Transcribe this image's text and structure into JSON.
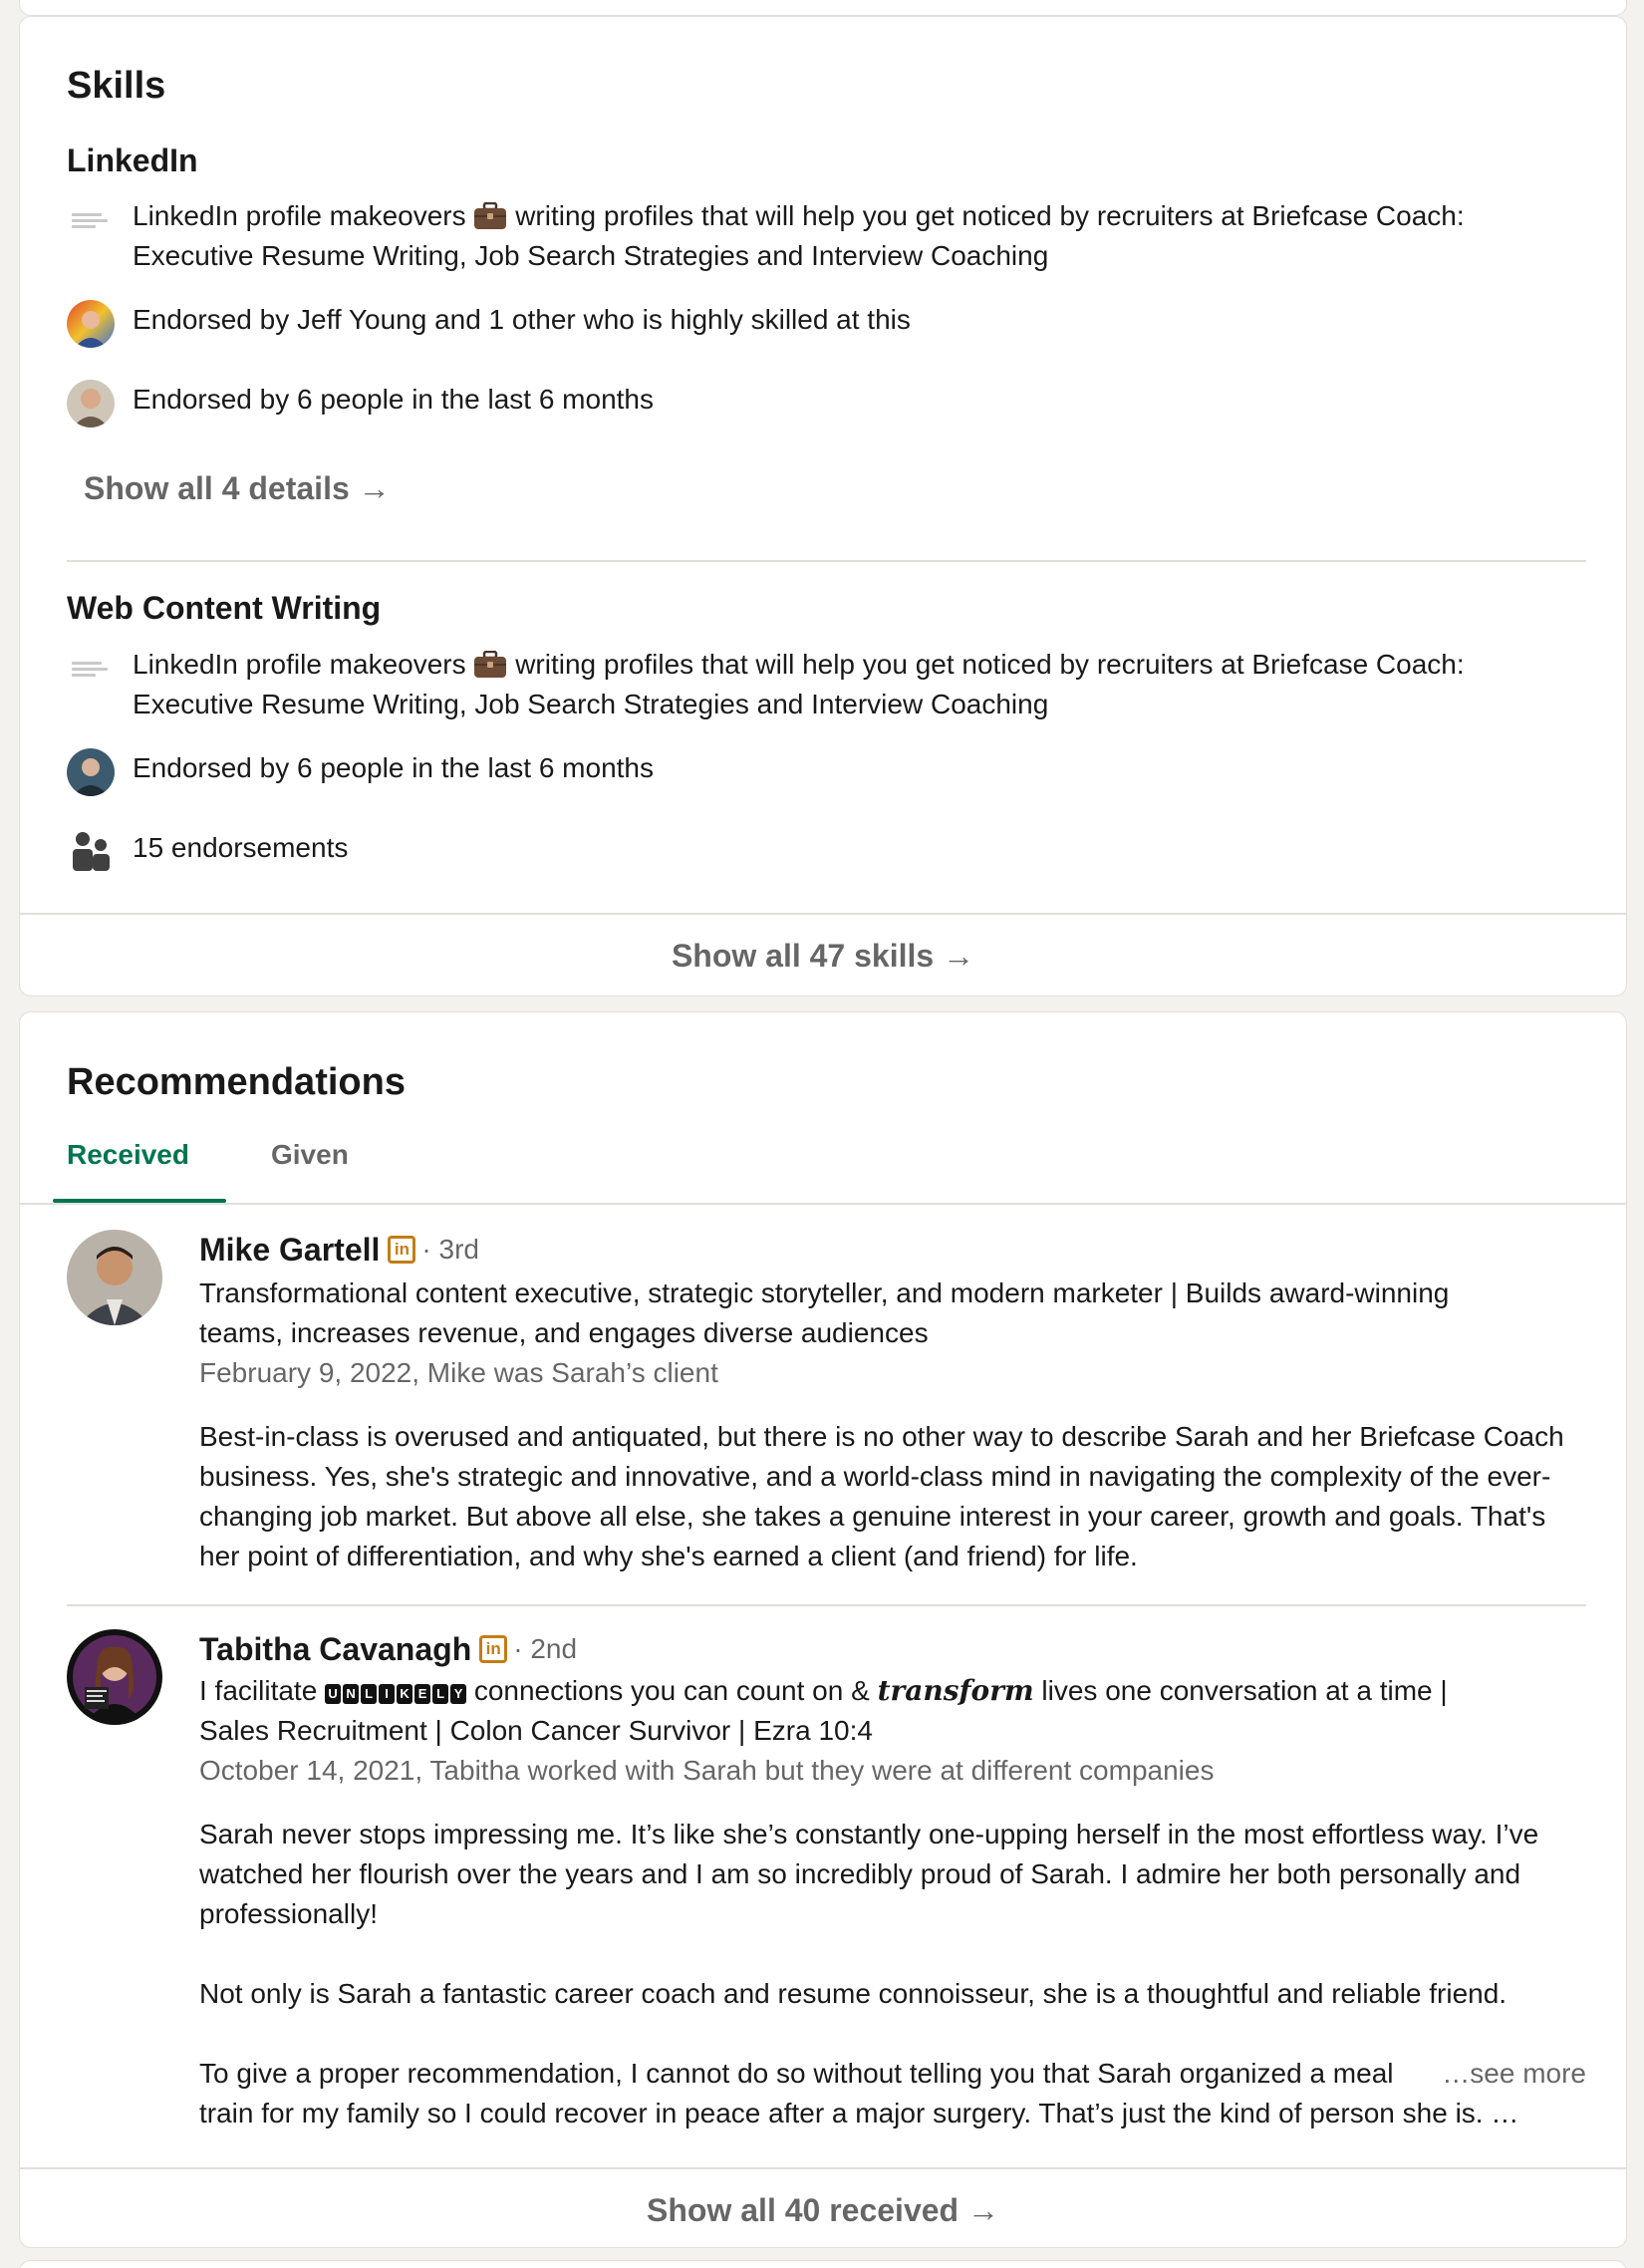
{
  "skills": {
    "title": "Skills",
    "items": [
      {
        "name": "LinkedIn",
        "context_pre": "LinkedIn profile makeovers",
        "context_post": "writing profiles that will help you get noticed by recruiters at Briefcase Coach:",
        "context_line2": "Executive Resume Writing, Job Search Strategies and Interview Coaching",
        "endorsement_1": "Endorsed by Jeff Young and 1 other who is highly skilled at this",
        "endorsement_2": "Endorsed by 6 people in the last 6 months",
        "show_details": "Show all 4 details →"
      },
      {
        "name": "Web Content Writing",
        "context_pre": "LinkedIn profile makeovers",
        "context_post": "writing profiles that will help you get noticed by recruiters at Briefcase Coach:",
        "context_line2": "Executive Resume Writing, Job Search Strategies and Interview Coaching",
        "endorsement_1": "Endorsed by 6 people in the last 6 months",
        "endorsement_count": "15 endorsements"
      }
    ],
    "show_all": "Show all 47 skills →"
  },
  "recommendations": {
    "title": "Recommendations",
    "tabs": {
      "received": "Received",
      "given": "Given"
    },
    "items": [
      {
        "name": "Mike Gartell",
        "badge": "in",
        "degree": "· 3rd",
        "headline_1": "Transformational content executive, strategic storyteller, and modern marketer | Builds award-winning",
        "headline_2": "teams, increases revenue, and engages diverse audiences",
        "meta": "February 9, 2022, Mike was Sarah’s client",
        "text": "Best-in-class is overused and antiquated, but there is no other way to describe Sarah and her Briefcase Coach business. Yes, she's strategic and innovative, and a world-class mind in navigating the complexity of the ever-changing job market. But above all else, she takes a genuine interest in your career, growth and goals. That's her point of differentiation, and why she's earned a client (and friend) for life."
      },
      {
        "name": "Tabitha Cavanagh",
        "badge": "in",
        "degree": "· 2nd",
        "headline_pre": "I facilitate",
        "headline_boxed": "UNLIKELY",
        "headline_mid": "connections you can count on &",
        "headline_fancy": "transform",
        "headline_post": "lives one conversation at a time |",
        "headline_2": "Sales Recruitment | Colon Cancer Survivor | Ezra 10:4",
        "meta": "October 14, 2021, Tabitha worked with Sarah but they were at different companies",
        "para_1": "Sarah never stops impressing me. It’s like she’s constantly one-upping herself in the most effortless way. I’ve watched her flourish over the years and I am so incredibly proud of Sarah. I admire her both personally and professionally!",
        "para_2": "Not only is Sarah a fantastic career coach and resume connoisseur, she is a thoughtful and reliable friend.",
        "para_3": "To give a proper recommendation, I cannot do so without telling you that Sarah organized a meal train for my family so I could recover in peace after a major surgery. That’s just the kind of person she is. …",
        "see_more": "…see more"
      }
    ],
    "show_all": "Show all 40 received →"
  },
  "colors": {
    "accent": "#01754f",
    "badge": "#c37d16",
    "background": "#f4f2ee"
  },
  "icons": [
    "company-logo-icon",
    "briefcase-emoji-icon",
    "people-icon",
    "linkedin-badge-icon",
    "arrow-right-icon"
  ]
}
